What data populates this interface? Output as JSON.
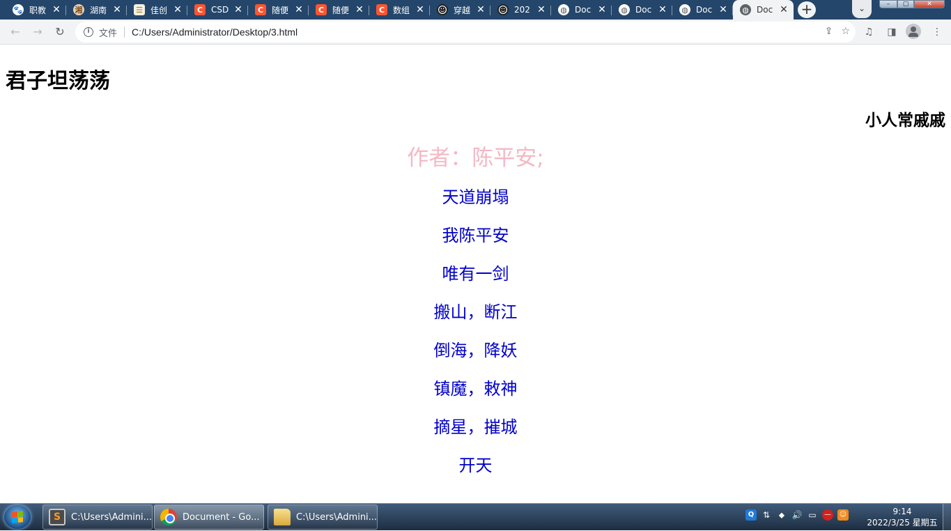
{
  "browser": {
    "tabs": [
      {
        "icon": "baidu-paw-icon",
        "favicon_class": "baidu",
        "glyph": "🐾",
        "title": "职教"
      },
      {
        "icon": "hunan-logo-icon",
        "favicon_class": "hunan",
        "glyph": "湘",
        "title": "湖南"
      },
      {
        "icon": "jiachuang-logo-icon",
        "favicon_class": "jiachuang",
        "glyph": "☰",
        "title": "佳创"
      },
      {
        "icon": "csdn-icon",
        "favicon_class": "csdn",
        "glyph": "C",
        "title": "CSD"
      },
      {
        "icon": "csdn-icon",
        "favicon_class": "csdn",
        "glyph": "C",
        "title": "随便"
      },
      {
        "icon": "csdn-icon",
        "favicon_class": "csdn",
        "glyph": "C",
        "title": "随便"
      },
      {
        "icon": "csdn-icon",
        "favicon_class": "csdn",
        "glyph": "C",
        "title": "数组"
      },
      {
        "icon": "dark-face-icon",
        "favicon_class": "dark",
        "glyph": "☻",
        "title": "穿越"
      },
      {
        "icon": "dark-face-icon",
        "favicon_class": "dark",
        "glyph": "☻",
        "title": "202"
      },
      {
        "icon": "globe-icon",
        "favicon_class": "globe",
        "glyph": "◍",
        "title": "Doc"
      },
      {
        "icon": "globe-icon",
        "favicon_class": "globe",
        "glyph": "◍",
        "title": "Doc"
      },
      {
        "icon": "globe-icon",
        "favicon_class": "globe",
        "glyph": "◍",
        "title": "Doc"
      },
      {
        "icon": "globe-icon",
        "favicon_class": "globe",
        "glyph": "◍",
        "title": "Doc",
        "active": true
      }
    ],
    "tab_close_glyph": "✕",
    "new_tab_glyph": "+",
    "tab_search_glyph": "⌄",
    "address": {
      "scheme_label": "文件",
      "url": "C:/Users/Administrator/Desktop/3.html"
    }
  },
  "page": {
    "heading_left": "君子坦荡荡",
    "heading_right": "小人常戚戚",
    "author": "作者：陈平安;",
    "poem_lines": [
      "天道崩塌",
      "我陈平安",
      "唯有一剑",
      "搬山，断江",
      "倒海，降妖",
      "镇魔，敕神",
      "摘星，摧城",
      "开天"
    ],
    "colors": {
      "author": "#f4b8c4",
      "poem": "#0000cc",
      "tab_strip": "#24466b"
    }
  },
  "taskbar": {
    "items": [
      {
        "icon": "sublime-text-icon",
        "icon_class": "sublime",
        "glyph": "S",
        "label": "C:\\Users\\Admini..."
      },
      {
        "icon": "chrome-icon",
        "icon_class": "chrome",
        "glyph": "",
        "label": "Document - Go..."
      },
      {
        "icon": "folder-icon",
        "icon_class": "folder",
        "glyph": "",
        "label": "C:\\Users\\Admini..."
      }
    ],
    "clock": {
      "time": "9:14",
      "date": "2022/3/25 星期五"
    }
  }
}
